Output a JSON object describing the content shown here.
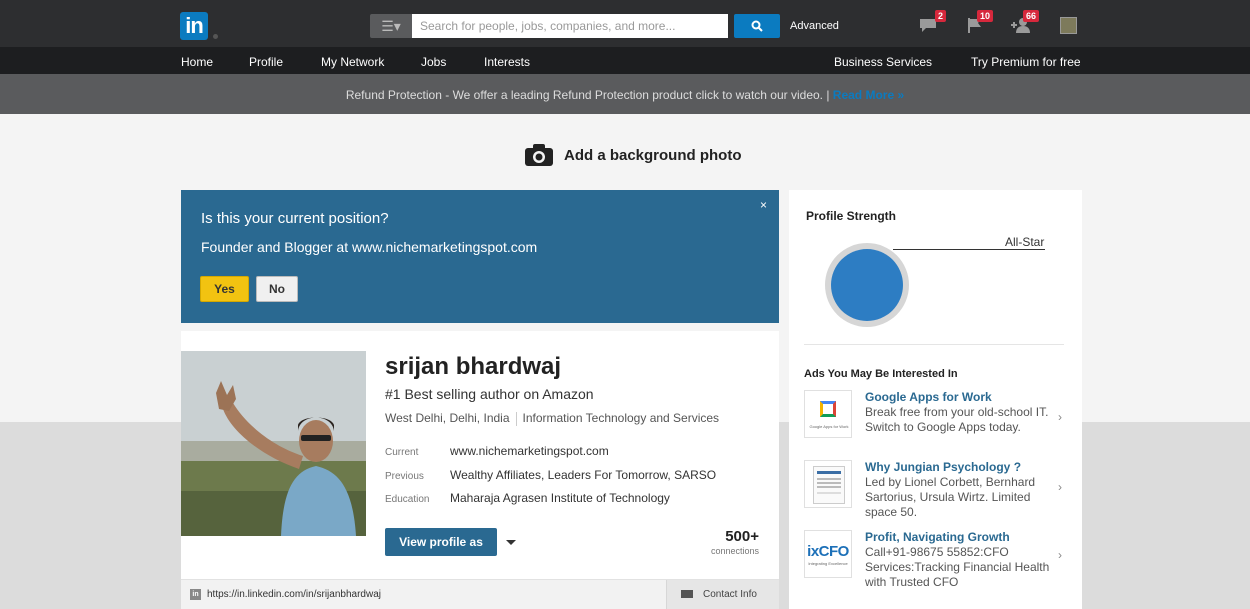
{
  "header": {
    "logo": "in",
    "search_placeholder": "Search for people, jobs, companies, and more...",
    "advanced_label": "Advanced",
    "messages_badge": "2",
    "notifications_badge": "10",
    "connections_badge": "66"
  },
  "nav": {
    "items": [
      "Home",
      "Profile",
      "My Network",
      "Jobs",
      "Interests"
    ],
    "business": "Business Services",
    "premium": "Try Premium for free"
  },
  "banner": {
    "text": "Refund Protection - We offer a leading Refund Protection product click to watch our video.  |  ",
    "link": "Read More »"
  },
  "background": {
    "label": "Add a background photo"
  },
  "position_prompt": {
    "question": "Is this your current position?",
    "detail": "Founder and Blogger at www.nichemarketingspot.com",
    "yes": "Yes",
    "no": "No",
    "close": "×"
  },
  "profile": {
    "name": "srijan bhardwaj",
    "headline": "#1 Best selling author on Amazon",
    "location": "West Delhi, Delhi, India",
    "industry": "Information Technology and Services",
    "current_label": "Current",
    "current": "www.nichemarketingspot.com",
    "previous_label": "Previous",
    "previous": "Wealthy Affiliates, Leaders For Tomorrow, SARSO",
    "education_label": "Education",
    "education": "Maharaja Agrasen Institute of Technology",
    "view_button": "View profile as",
    "connections_count": "500+",
    "connections_label": "connections",
    "url": "https://in.linkedin.com/in/srijanbhardwaj",
    "contact_info": "Contact Info"
  },
  "sidebar": {
    "strength_title": "Profile Strength",
    "strength_level": "All-Star",
    "ads_title": "Ads You May Be Interested In",
    "ads": [
      {
        "title": "Google Apps for Work",
        "desc": "Break free from your old-school IT. Switch to Google Apps today.",
        "thumb_text": "Google Apps for Work"
      },
      {
        "title": "Why Jungian Psychology ?",
        "desc": "Led by Lionel Corbett, Bernhard Sartorius, Ursula Wirtz. Limited space 50."
      },
      {
        "title": "Profit, Navigating Growth",
        "desc": "Call+91-98675 55852:CFO Services:Tracking Financial Health with Trusted CFO",
        "thumb_text": "ixCFO",
        "thumb_sub": "Integrating Excellence"
      }
    ]
  },
  "colors": {
    "topbar": "#2d2e30",
    "navbar": "#1d1e20",
    "brand_blue": "#0b7bc0",
    "card_blue": "#2a6991",
    "yes_yellow": "#f2c311",
    "badge_red": "#d6283c"
  },
  "icons": {
    "search": "search-icon",
    "messages": "messages-icon",
    "notifications": "flag-icon",
    "connections": "add-connection-icon",
    "camera": "camera-icon"
  }
}
